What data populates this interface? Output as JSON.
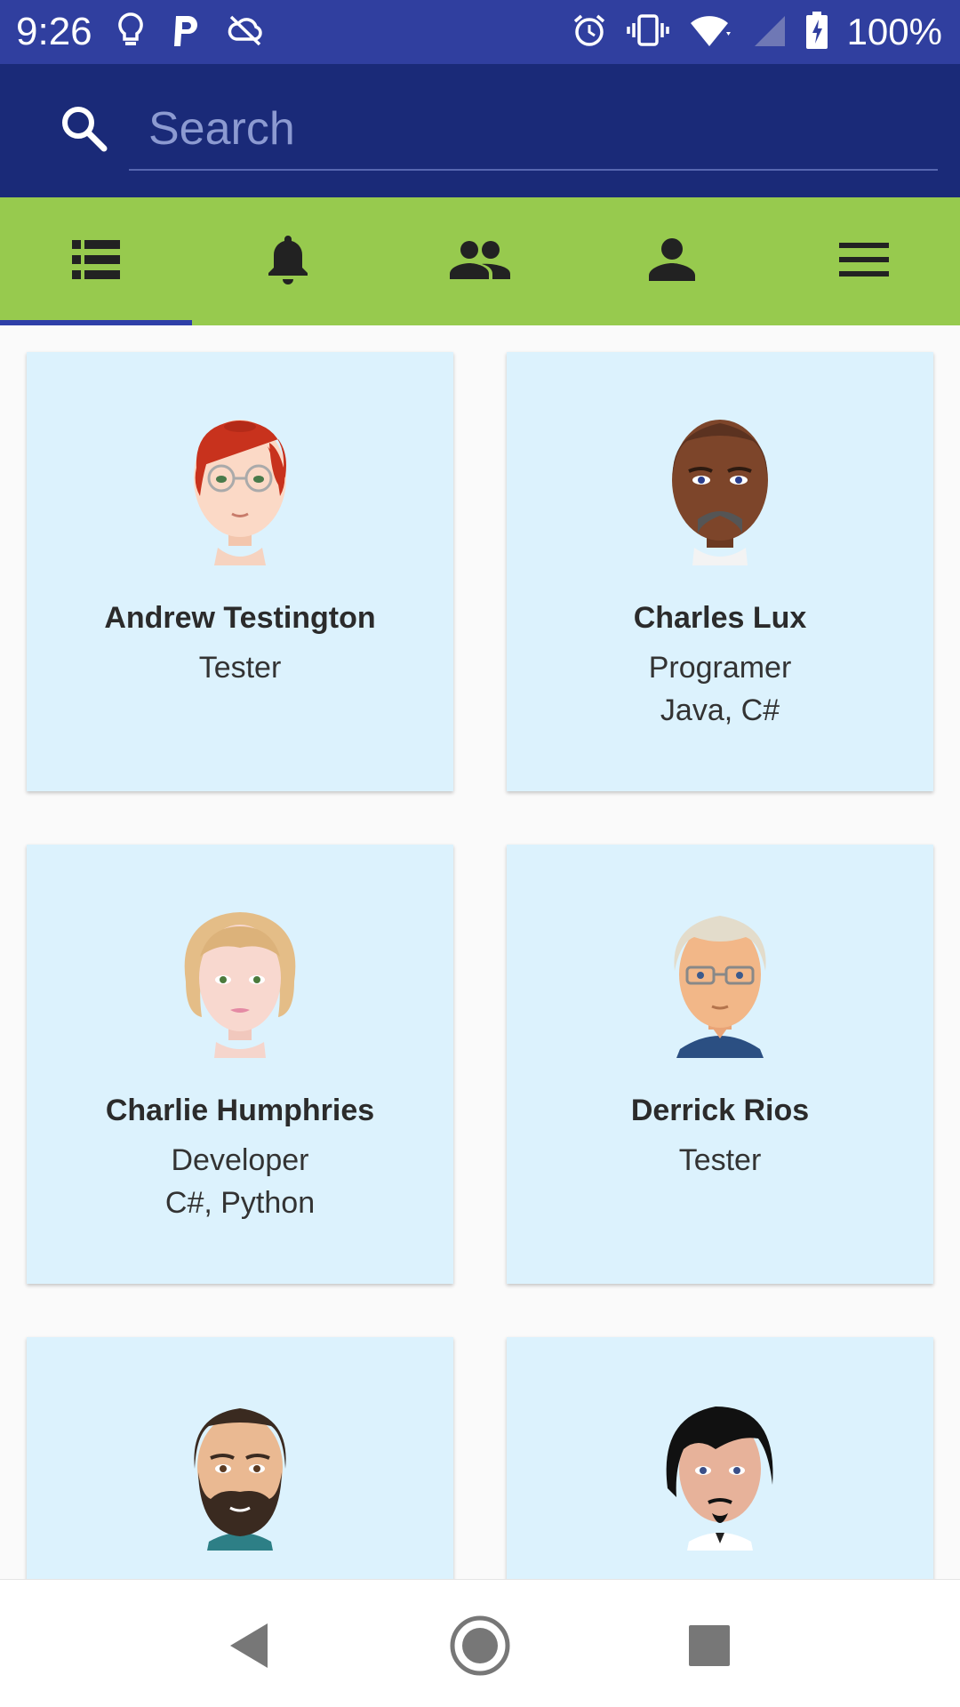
{
  "status_bar": {
    "time": "9:26",
    "battery": "100%",
    "icons": [
      "lightbulb-icon",
      "parking-icon",
      "cloud-off-icon",
      "alarm-icon",
      "vibrate-icon",
      "wifi-icon",
      "cell-signal-icon",
      "battery-charging-icon"
    ]
  },
  "search": {
    "placeholder": "Search",
    "icon": "search-icon"
  },
  "tabs": [
    {
      "icon": "list-icon",
      "active": true
    },
    {
      "icon": "bell-icon",
      "active": false
    },
    {
      "icon": "group-icon",
      "active": false
    },
    {
      "icon": "person-icon",
      "active": false
    },
    {
      "icon": "menu-icon",
      "active": false
    }
  ],
  "colors": {
    "status_bar": "#303f9f",
    "search_bar": "#1a2a78",
    "tab_bar": "#97ca4e",
    "tab_indicator": "#2f3fa8",
    "card_bg": "#dcf2fd"
  },
  "people": [
    {
      "name": "Andrew Testington",
      "role": "Tester",
      "skills": "",
      "avatar": "bald-redhead-glasses-avatar"
    },
    {
      "name": "Charles Lux",
      "role": "Programer",
      "skills": "Java,  C#",
      "avatar": "dark-skin-mustache-avatar"
    },
    {
      "name": "Charlie Humphries",
      "role": "Developer",
      "skills": "C#, Python",
      "avatar": "blonde-woman-avatar"
    },
    {
      "name": "Derrick Rios",
      "role": "Tester",
      "skills": "",
      "avatar": "gray-hair-glasses-avatar"
    },
    {
      "name": "",
      "role": "",
      "skills": "",
      "avatar": "bearded-man-avatar"
    },
    {
      "name": "",
      "role": "",
      "skills": "",
      "avatar": "black-hair-goatee-avatar"
    }
  ],
  "nav": [
    "back-icon",
    "home-icon",
    "recents-icon"
  ]
}
